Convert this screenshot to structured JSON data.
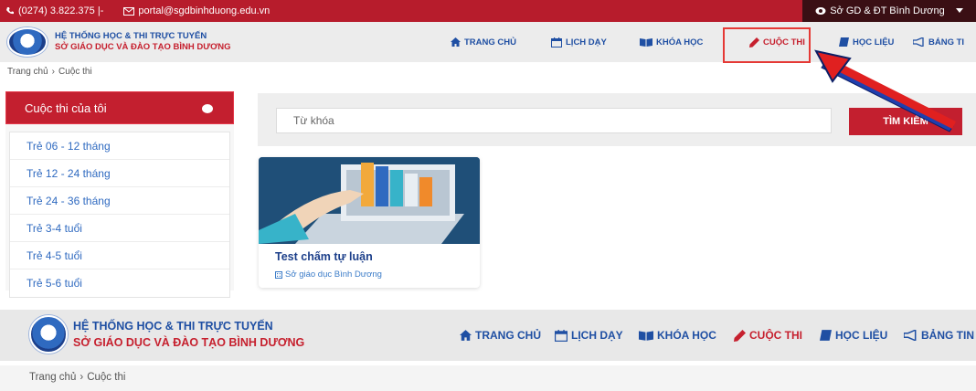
{
  "topbar": {
    "phone": "(0274) 3.822.375 |-",
    "email": "portal@sgdbinhduong.edu.vn",
    "org": "Sở GD & ĐT Bình Dương"
  },
  "header": {
    "title_line1": "HỆ THỐNG HỌC & THI TRỰC TUYẾN",
    "title_line2": "SỞ GIÁO DỤC VÀ ĐÀO TẠO BÌNH DƯƠNG",
    "nav": [
      {
        "label": "TRANG CHỦ",
        "icon": "home-icon"
      },
      {
        "label": "LỊCH DẠY",
        "icon": "calendar-icon"
      },
      {
        "label": "KHÓA HỌC",
        "icon": "book-open-icon"
      },
      {
        "label": "CUỘC THI",
        "icon": "pencil-icon",
        "active": true
      },
      {
        "label": "HỌC LIỆU",
        "icon": "book-icon"
      },
      {
        "label": "BẢNG TIN",
        "icon": "megaphone-icon"
      }
    ],
    "nav_cut": "BẢNG TI"
  },
  "breadcrumb": {
    "home": "Trang chủ",
    "separator": "›",
    "current": "Cuộc thi"
  },
  "sidebar": {
    "heading": "Cuộc thi của tôi",
    "items": [
      {
        "label": "Trẻ 06 - 12 tháng"
      },
      {
        "label": "Trẻ 12 - 24 tháng"
      },
      {
        "label": "Trẻ 24 - 36 tháng"
      },
      {
        "label": "Trẻ 3-4 tuổi"
      },
      {
        "label": "Trẻ 4-5 tuổi"
      },
      {
        "label": "Trẻ 5-6 tuổi"
      }
    ]
  },
  "search": {
    "placeholder": "Từ khóa",
    "button": "TÌM KIẾM"
  },
  "card": {
    "title": "Test chấm tự luận",
    "publisher": "Sở giáo dục Bình Dương"
  },
  "colors": {
    "brand_red": "#c31f2f",
    "brand_blue": "#1f4fa3",
    "annotation": "#e53935"
  }
}
